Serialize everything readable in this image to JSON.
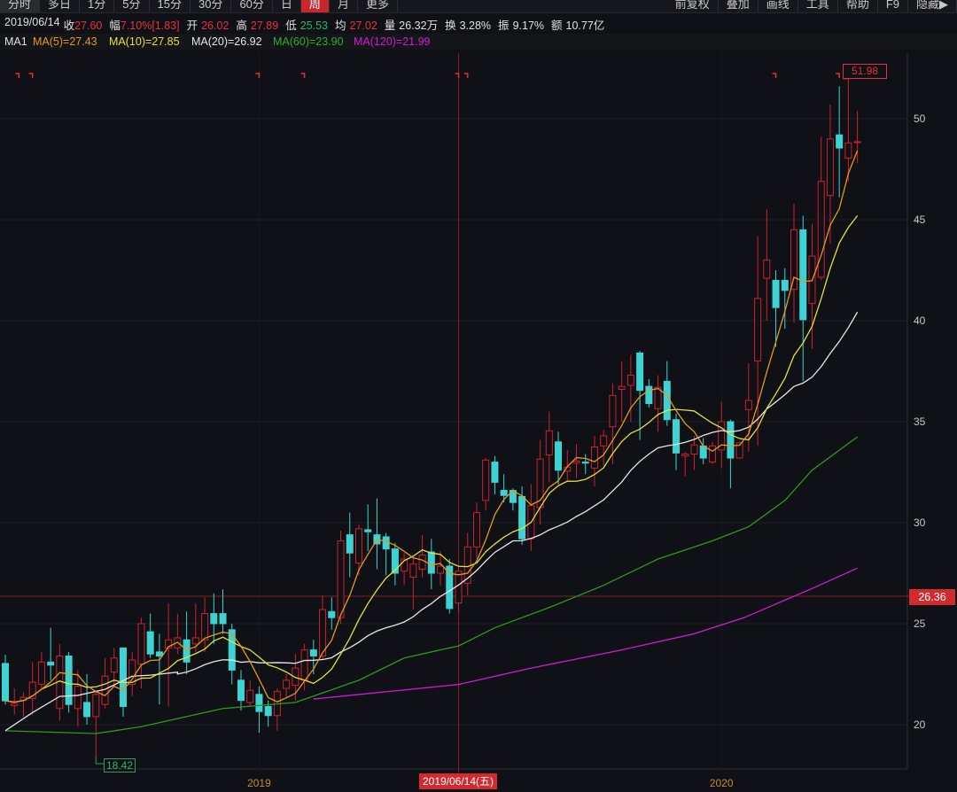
{
  "toolbar": {
    "left": [
      "分时",
      "多日",
      "1分",
      "5分",
      "15分",
      "30分",
      "60分",
      "日",
      "周",
      "月",
      "更多"
    ],
    "active": "周",
    "right": [
      "前复权",
      "叠加",
      "画线",
      "工具",
      "帮助",
      "F9",
      "隐藏▶"
    ]
  },
  "info": {
    "date": "2019/06/14",
    "close_label": "收",
    "close": "27.60",
    "change_label": "幅",
    "change": "7.10%[1.83]",
    "open_label": "开",
    "open": "26.02",
    "high_label": "高",
    "high": "27.89",
    "low_label": "低",
    "low": "25.53",
    "avg_label": "均",
    "avg": "27.02",
    "volume_label": "量",
    "volume": "26.32万",
    "turnover_label": "换",
    "turnover": "3.28%",
    "amplitude_label": "振",
    "amplitude": "9.17%",
    "amount_label": "额",
    "amount": "10.77亿"
  },
  "ma_row": {
    "name": "MA1",
    "ma5": "MA(5)=27.43",
    "ma10": "MA(10)=27.85",
    "ma20": "MA(20)=26.92",
    "ma60": "MA(60)=23.90",
    "ma120": "MA(120)=21.99"
  },
  "colors": {
    "up": "#d0202a",
    "down": "#3fd2d2",
    "ma5": "#e39a1c",
    "ma10": "#e6e03a",
    "ma20": "#e6e6e6",
    "ma60": "#2c9a1f",
    "ma120": "#d21ad6",
    "crosshair": "#8a1a1e"
  },
  "crosshair": {
    "date_label": "2019/06/14(五)",
    "price_label": "26.36",
    "price": 26.36,
    "index": 50
  },
  "extremes": {
    "high_label": "51.98",
    "high_index": 93,
    "low_label": "18.42",
    "low_index": 10
  },
  "chart_data": {
    "type": "candlestick",
    "period": "weekly",
    "ylim": [
      16.8,
      53.2
    ],
    "yticks": [
      20,
      25,
      30,
      35,
      40,
      45,
      50
    ],
    "x_labels": [
      {
        "label": "2019",
        "index": 28
      },
      {
        "label": "2020",
        "index": 79
      }
    ],
    "event_markers": [
      1.5,
      3,
      28,
      33,
      50,
      51,
      85,
      92
    ],
    "ohlc": [
      [
        23.03,
        23.46,
        21.0,
        21.18
      ],
      [
        20.95,
        21.8,
        20.5,
        21.05
      ],
      [
        21.2,
        21.6,
        20.4,
        21.35
      ],
      [
        21.3,
        23.1,
        20.5,
        22.1
      ],
      [
        22.0,
        23.6,
        21.8,
        23.1
      ],
      [
        23.1,
        24.8,
        22.2,
        22.95
      ],
      [
        20.8,
        24.0,
        20.2,
        23.4
      ],
      [
        23.4,
        23.6,
        20.6,
        21.0
      ],
      [
        20.8,
        22.7,
        19.9,
        21.9
      ],
      [
        21.1,
        22.5,
        20.0,
        20.4
      ],
      [
        20.4,
        21.7,
        18.42,
        21.5
      ],
      [
        21.0,
        23.3,
        20.8,
        22.4
      ],
      [
        22.6,
        23.8,
        21.9,
        23.3
      ],
      [
        23.8,
        23.8,
        20.4,
        20.9
      ],
      [
        22.0,
        23.6,
        21.4,
        23.2
      ],
      [
        23.0,
        25.3,
        21.8,
        25.0
      ],
      [
        24.6,
        25.5,
        23.3,
        23.5
      ],
      [
        23.6,
        24.5,
        21.0,
        23.4
      ],
      [
        23.8,
        26.0,
        20.9,
        24.2
      ],
      [
        23.8,
        25.5,
        23.5,
        24.3
      ],
      [
        24.2,
        25.6,
        22.5,
        23.1
      ],
      [
        24.0,
        26.0,
        23.6,
        24.3
      ],
      [
        24.2,
        26.3,
        23.6,
        25.5
      ],
      [
        25.5,
        26.5,
        24.0,
        25.0
      ],
      [
        25.5,
        26.7,
        24.5,
        25.0
      ],
      [
        24.7,
        25.0,
        22.0,
        22.7
      ],
      [
        22.2,
        22.7,
        20.7,
        21.2
      ],
      [
        21.1,
        22.2,
        20.9,
        21.7
      ],
      [
        21.5,
        21.9,
        19.6,
        20.65
      ],
      [
        20.9,
        21.2,
        19.9,
        20.45
      ],
      [
        20.45,
        21.8,
        19.7,
        21.65
      ],
      [
        21.8,
        22.5,
        21.3,
        22.2
      ],
      [
        21.95,
        23.5,
        21.2,
        22.8
      ],
      [
        22.2,
        24.0,
        21.7,
        23.7
      ],
      [
        23.7,
        24.2,
        22.5,
        23.4
      ],
      [
        23.4,
        26.4,
        23.2,
        25.7
      ],
      [
        25.6,
        26.3,
        24.7,
        25.3
      ],
      [
        25.3,
        29.6,
        25.0,
        29.1
      ],
      [
        29.4,
        30.5,
        27.3,
        28.5
      ],
      [
        28.0,
        29.9,
        27.4,
        29.7
      ],
      [
        29.65,
        30.9,
        28.6,
        29.55
      ],
      [
        29.4,
        31.2,
        27.7,
        28.95
      ],
      [
        29.3,
        29.5,
        27.4,
        28.7
      ],
      [
        28.7,
        29.0,
        26.9,
        27.5
      ],
      [
        27.6,
        28.5,
        26.9,
        28.2
      ],
      [
        27.3,
        28.3,
        25.7,
        27.95
      ],
      [
        27.7,
        29.4,
        27.3,
        28.4
      ],
      [
        28.55,
        29.2,
        26.7,
        27.5
      ],
      [
        27.5,
        28.6,
        26.9,
        27.85
      ],
      [
        27.85,
        28.2,
        25.5,
        25.75
      ],
      [
        26.02,
        27.89,
        25.53,
        27.6
      ],
      [
        27.0,
        29.5,
        26.4,
        28.8
      ],
      [
        28.8,
        31.0,
        28.2,
        30.5
      ],
      [
        31.1,
        33.2,
        30.6,
        33.1
      ],
      [
        33.0,
        33.3,
        31.4,
        32.0
      ],
      [
        31.6,
        32.4,
        31.0,
        31.35
      ],
      [
        31.6,
        31.7,
        30.6,
        31.0
      ],
      [
        31.3,
        31.8,
        28.9,
        29.2
      ],
      [
        29.2,
        31.9,
        28.6,
        30.85
      ],
      [
        30.75,
        34.1,
        29.9,
        33.15
      ],
      [
        33.35,
        35.5,
        32.0,
        34.55
      ],
      [
        34.0,
        34.5,
        31.9,
        32.6
      ],
      [
        32.55,
        33.6,
        32.0,
        32.75
      ],
      [
        32.95,
        33.9,
        32.2,
        33.05
      ],
      [
        33.0,
        33.4,
        32.4,
        32.95
      ],
      [
        32.7,
        34.3,
        31.8,
        33.75
      ],
      [
        33.8,
        34.6,
        32.8,
        34.3
      ],
      [
        34.75,
        36.9,
        32.9,
        36.3
      ],
      [
        36.6,
        38.0,
        35.0,
        36.75
      ],
      [
        36.8,
        38.3,
        35.0,
        37.3
      ],
      [
        38.4,
        38.5,
        34.1,
        36.55
      ],
      [
        36.75,
        37.1,
        35.7,
        35.9
      ],
      [
        35.65,
        37.3,
        34.5,
        36.7
      ],
      [
        37.0,
        38.0,
        34.8,
        35.1
      ],
      [
        35.1,
        35.4,
        32.6,
        33.45
      ],
      [
        33.3,
        33.5,
        32.3,
        33.4
      ],
      [
        33.4,
        34.3,
        32.6,
        33.85
      ],
      [
        33.8,
        34.2,
        32.9,
        33.2
      ],
      [
        33.0,
        34.0,
        32.9,
        33.8
      ],
      [
        33.6,
        36.0,
        32.7,
        35.0
      ],
      [
        35.0,
        35.1,
        31.7,
        33.2
      ],
      [
        33.2,
        34.0,
        33.2,
        33.95
      ],
      [
        35.6,
        37.9,
        33.5,
        36.05
      ],
      [
        38.0,
        44.2,
        33.8,
        41.1
      ],
      [
        42.1,
        45.5,
        40.0,
        43.0
      ],
      [
        42.0,
        42.5,
        38.7,
        40.65
      ],
      [
        42.0,
        42.6,
        39.6,
        41.5
      ],
      [
        41.55,
        45.8,
        39.9,
        44.5
      ],
      [
        44.5,
        45.2,
        37.0,
        40.05
      ],
      [
        40.85,
        44.8,
        38.6,
        43.2
      ],
      [
        42.15,
        49.1,
        42.0,
        46.9
      ],
      [
        46.2,
        50.7,
        43.8,
        49.0
      ],
      [
        49.2,
        51.6,
        46.1,
        48.55
      ],
      [
        48.05,
        51.98,
        46.9,
        48.8
      ],
      [
        48.85,
        50.4,
        47.8,
        48.86
      ]
    ],
    "ma_computed_periods": [
      5,
      10,
      20
    ],
    "ma20_early": [
      [
        0,
        19.7
      ],
      [
        3,
        20.6
      ],
      [
        6,
        21.4
      ],
      [
        8,
        21.45
      ],
      [
        11,
        21.75
      ],
      [
        14,
        22.4
      ],
      [
        16,
        22.45
      ],
      [
        19,
        22.6
      ]
    ],
    "ma60": [
      [
        0,
        19.7
      ],
      [
        10,
        19.56
      ],
      [
        15,
        19.9
      ],
      [
        24,
        20.8
      ],
      [
        32,
        21.1
      ],
      [
        39,
        22.2
      ],
      [
        44,
        23.3
      ],
      [
        50,
        23.9
      ],
      [
        54,
        24.8
      ],
      [
        60,
        25.8
      ],
      [
        66,
        26.9
      ],
      [
        72,
        28.2
      ],
      [
        78,
        29.1
      ],
      [
        82,
        29.8
      ],
      [
        86,
        31.1
      ],
      [
        89,
        32.6
      ],
      [
        94,
        34.25
      ]
    ],
    "ma120": [
      [
        34,
        21.27
      ],
      [
        50,
        21.99
      ],
      [
        58,
        22.8
      ],
      [
        68,
        23.7
      ],
      [
        76,
        24.5
      ],
      [
        81.5,
        25.3
      ],
      [
        85.4,
        26.05
      ],
      [
        89.3,
        26.8
      ],
      [
        94,
        27.75
      ]
    ]
  }
}
